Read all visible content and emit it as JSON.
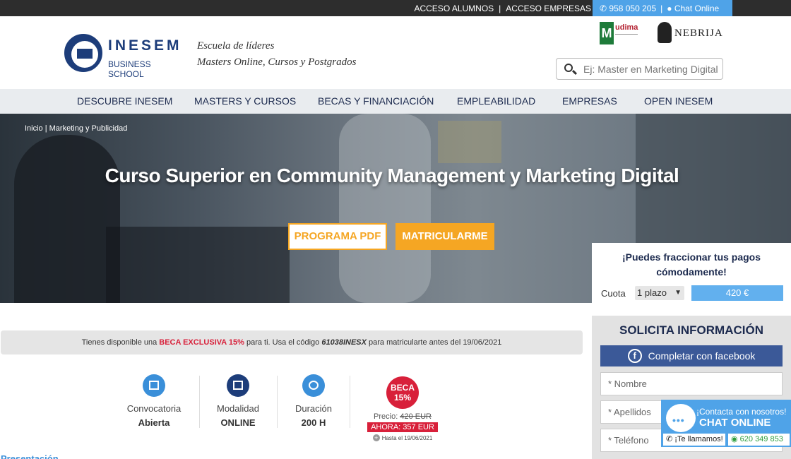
{
  "topbar": {
    "alumnos": "ACCESO ALUMNOS",
    "sep": "|",
    "empresas": "ACCESO EMPRESAS",
    "phone": "958 050 205",
    "chat": "Chat Online"
  },
  "header": {
    "logo_name": "INESEM",
    "logo_sub": "BUSINESS SCHOOL",
    "tagline_1": "Escuela de líderes",
    "tagline_2": "Masters Online, Cursos y Postgrados",
    "udima_text": "udima",
    "nebrija_text": "NEBRIJA",
    "search_placeholder": "Ej: Master en Marketing Digital"
  },
  "nav": {
    "items": [
      "DESCUBRE INESEM",
      "MASTERS Y CURSOS",
      "BECAS Y FINANCIACIÓN",
      "EMPLEABILIDAD",
      "EMPRESAS",
      "OPEN INESEM"
    ]
  },
  "hero": {
    "breadcrumb": "Inicio | Marketing y Publicidad",
    "title": "Curso Superior en Community Management y Marketing Digital",
    "btn_pdf": "PROGRAMA PDF",
    "btn_matricula": "MATRICULARME"
  },
  "payment": {
    "title_1": "¡Puedes fraccionar tus pagos",
    "title_2": "cómodamente!",
    "cuota_label": "Cuota",
    "plazo": "1 plazo",
    "price": "420 €"
  },
  "form": {
    "title": "SOLICITA INFORMACIÓN",
    "facebook": "Completar con facebook",
    "nombre": "* Nombre",
    "apellidos": "* Apellidos",
    "telefono": "* Teléfono"
  },
  "chat_widget": {
    "line1": "¡Contacta con nosotros!",
    "line2": "CHAT ONLINE",
    "call": "¡Te llamamos!",
    "whatsapp": "620 349 853"
  },
  "beca_banner": {
    "pre": "Tienes disponible una ",
    "beca": "BECA EXCLUSIVA 15%",
    "mid": " para ti. Usa el código ",
    "code": "61038INESX",
    "post": " para matricularte antes del 19/06/2021"
  },
  "features": [
    {
      "label": "Convocatoria",
      "value": "Abierta"
    },
    {
      "label": "Modalidad",
      "value": "ONLINE"
    },
    {
      "label": "Duración",
      "value": "200 H"
    }
  ],
  "pricing": {
    "badge_1": "BECA",
    "badge_2": "15%",
    "precio_label": "Precio: ",
    "precio_old": "420 EUR",
    "ahora": "AHORA: 357 EUR",
    "hasta": "Hasta el 19/06/2021"
  },
  "section_title": "Presentación",
  "colors": {
    "brand": "#1d3d7a",
    "accent": "#f5a623",
    "blue": "#4fa3e8",
    "red": "#d8203a"
  }
}
